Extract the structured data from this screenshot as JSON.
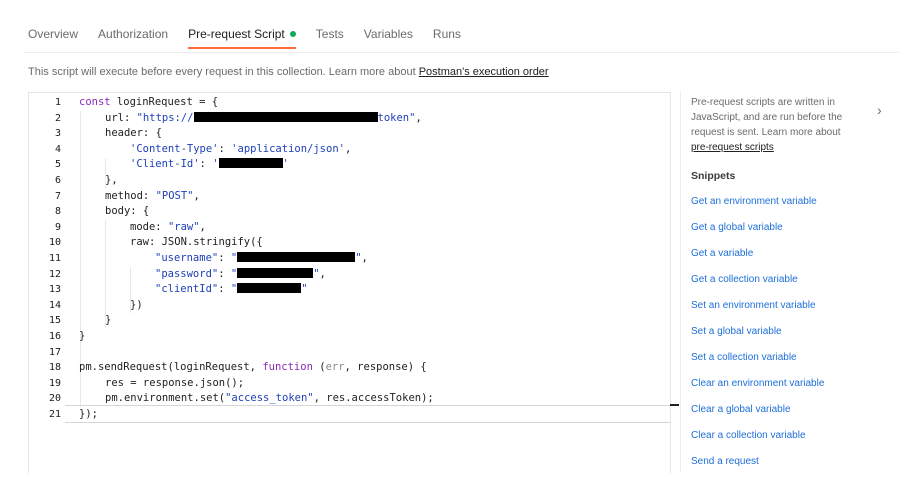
{
  "tabs": [
    {
      "label": "Overview"
    },
    {
      "label": "Authorization"
    },
    {
      "label": "Pre-request Script",
      "active": true,
      "indicator": "green-dot-icon"
    },
    {
      "label": "Tests"
    },
    {
      "label": "Variables"
    },
    {
      "label": "Runs"
    }
  ],
  "description": {
    "text": "This script will execute before every request in this collection. Learn more about ",
    "link": "Postman's execution order"
  },
  "editor": {
    "line_numbers": [
      "1",
      "2",
      "3",
      "4",
      "5",
      "6",
      "7",
      "8",
      "9",
      "10",
      "11",
      "12",
      "13",
      "14",
      "15",
      "16",
      "17",
      "18",
      "19",
      "20",
      "21"
    ],
    "code": {
      "l1_kw": "const",
      "l1_rest": " loginRequest = {",
      "l2_a": "url: ",
      "l2_s1": "\"https://",
      "l2_s2": "token\"",
      "l2_b": ",",
      "l3": "header: {",
      "l4_s1": "'Content-Type'",
      "l4_b": ": ",
      "l4_s2": "'application/json'",
      "l4_c": ",",
      "l5_s1": "'Client-Id'",
      "l5_b": ": ",
      "l5_s2": "'",
      "l5_s3": "'",
      "l6": "},",
      "l7_a": "method: ",
      "l7_s": "\"POST\"",
      "l7_b": ",",
      "l8": "body: {",
      "l9_a": "mode: ",
      "l9_s": "\"raw\"",
      "l9_b": ",",
      "l10": "raw: JSON.stringify({",
      "l11_s1": "\"username\"",
      "l11_b": ": ",
      "l11_s2": "\"",
      "l11_s3": "\"",
      "l11_c": ",",
      "l12_s1": "\"password\"",
      "l12_b": ": ",
      "l12_s2": "\"",
      "l12_s3": "\"",
      "l12_c": ",",
      "l13_s1": "\"clientId\"",
      "l13_b": ": ",
      "l13_s2": "\"",
      "l13_s3": "\"",
      "l14": "})",
      "l15": "}",
      "l16": "}",
      "l17": "",
      "l18_a": "pm.sendRequest(loginRequest, ",
      "l18_kw": "function",
      "l18_b": " (",
      "l18_p": "err",
      "l18_c": ", response) {",
      "l19": "res = response.json();",
      "l20_a": "pm.environment.set(",
      "l20_s": "\"access_token\"",
      "l20_b": ", res.accessToken);",
      "l21": "});"
    }
  },
  "sidebar": {
    "info_text": "Pre-request scripts are written in JavaScript, and are run before the request is sent. Learn more about ",
    "info_link": "pre-request scripts",
    "collapse_icon": "chevron-right-icon",
    "snippets_title": "Snippets",
    "snippets": [
      "Get an environment variable",
      "Get a global variable",
      "Get a variable",
      "Get a collection variable",
      "Set an environment variable",
      "Set a global variable",
      "Set a collection variable",
      "Clear an environment variable",
      "Clear a global variable",
      "Clear a collection variable",
      "Send a request"
    ]
  },
  "colors": {
    "active_tab_underline": "#ff6c37",
    "indicator_dot": "#10a85a",
    "snippet_link": "#1d6fd8",
    "keyword": "#8a2bb8",
    "string": "#1d3fb8"
  }
}
